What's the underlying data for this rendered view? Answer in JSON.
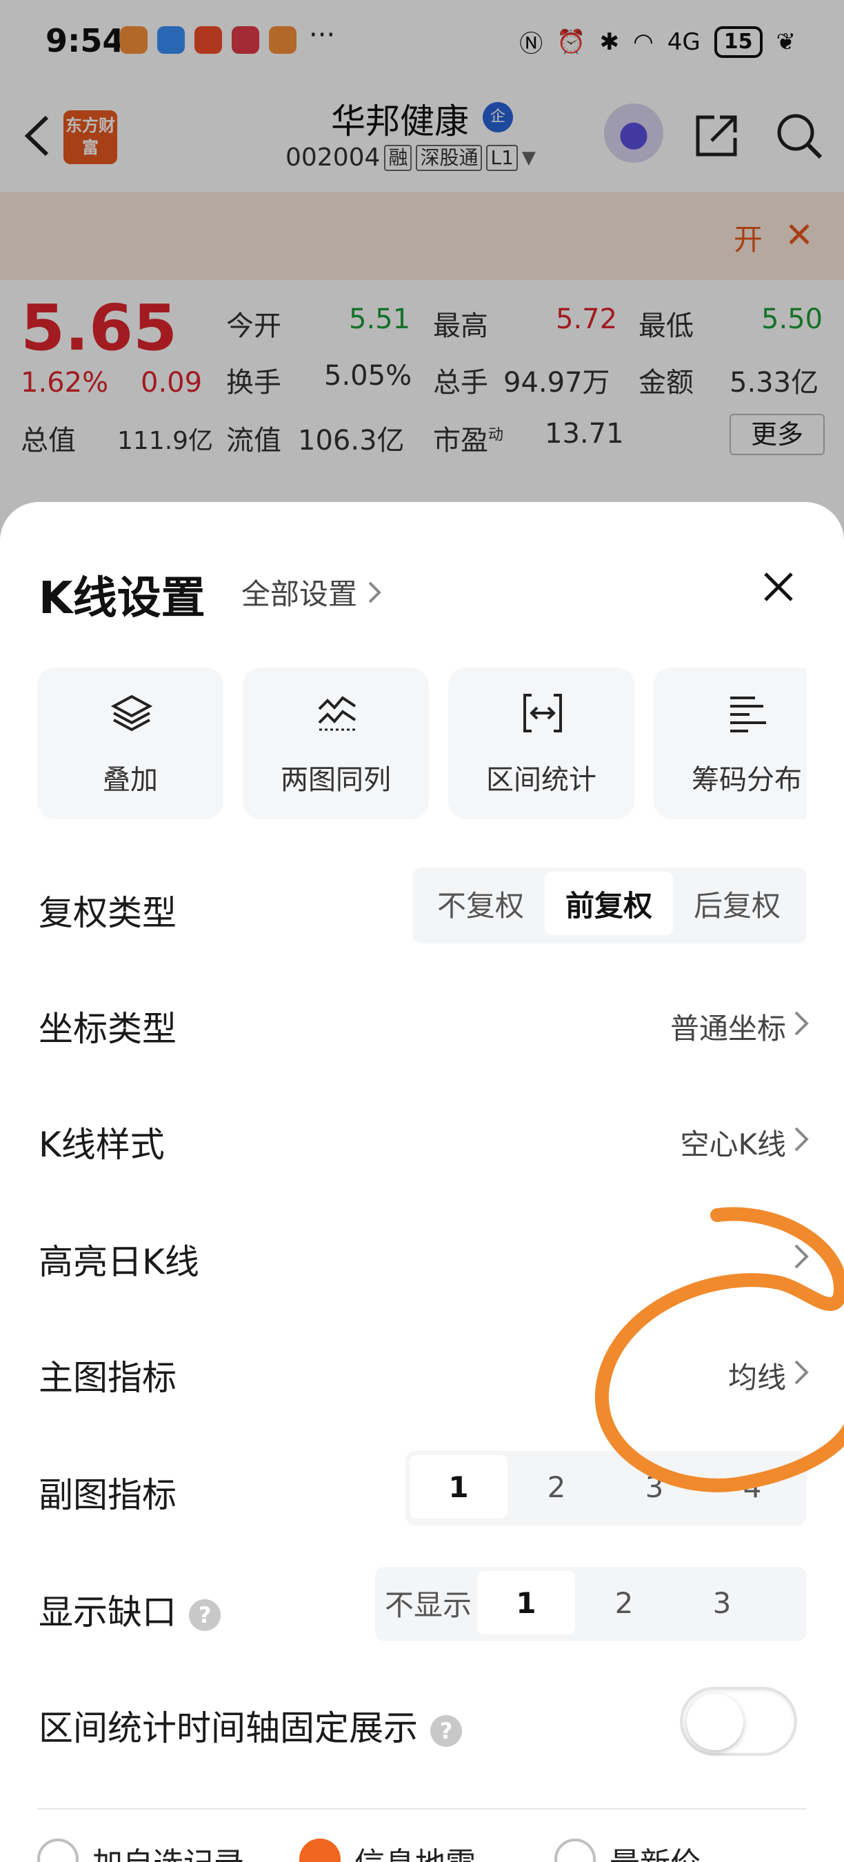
{
  "status_bar": {
    "time": "9:54",
    "more": "···",
    "battery": "15",
    "signal": "4G"
  },
  "header": {
    "back_icon": "chevron-left-icon",
    "logo_text": "东方财富",
    "stock_name": "华邦健康",
    "company_badge": "企",
    "stock_code": "002004",
    "tags": [
      "融",
      "深股通",
      "L1"
    ]
  },
  "banner": {
    "text": "开",
    "close": "✕"
  },
  "quote": {
    "price": "5.65",
    "change_pct": "1.62%",
    "change_amt": "0.09",
    "fields": [
      {
        "label": "今开",
        "value": "5.51",
        "color": "green"
      },
      {
        "label": "最高",
        "value": "5.72",
        "color": "red"
      },
      {
        "label": "最低",
        "value": "5.50",
        "color": "green"
      },
      {
        "label": "换手",
        "value": "5.05%",
        "color": "plain"
      },
      {
        "label": "总手",
        "value": "94.97万",
        "color": "plain"
      },
      {
        "label": "金额",
        "value": "5.33亿",
        "color": "plain"
      },
      {
        "label": "总值",
        "value": "111.9亿",
        "color": "plain"
      },
      {
        "label": "流值",
        "value": "106.3亿",
        "color": "plain"
      },
      {
        "label": "市盈",
        "sup": "动",
        "value": "13.71",
        "color": "plain"
      }
    ],
    "more_label": "更多"
  },
  "sheet": {
    "title": "K线设置",
    "all_settings": "全部设置",
    "tools": [
      {
        "label": "叠加",
        "icon": "layers-icon"
      },
      {
        "label": "两图同列",
        "icon": "dual-chart-icon"
      },
      {
        "label": "区间统计",
        "icon": "range-icon"
      },
      {
        "label": "筹码分布",
        "icon": "bars-icon"
      }
    ],
    "adjust": {
      "label": "复权类型",
      "options": [
        "不复权",
        "前复权",
        "后复权"
      ],
      "selected": "前复权"
    },
    "axis": {
      "label": "坐标类型",
      "value": "普通坐标"
    },
    "kline_style": {
      "label": "K线样式",
      "value": "空心K线"
    },
    "highlight": {
      "label": "高亮日K线",
      "value": ""
    },
    "main_indicator": {
      "label": "主图指标",
      "value": "均线"
    },
    "sub_indicator": {
      "label": "副图指标",
      "options": [
        "1",
        "2",
        "3",
        "4"
      ],
      "selected": "1"
    },
    "gap": {
      "label": "显示缺口",
      "help": "?",
      "options": [
        "不显示",
        "1",
        "2",
        "3"
      ],
      "selected": "1"
    },
    "axis_fixed": {
      "label": "区间统计时间轴固定展示",
      "help": "?",
      "enabled": false
    },
    "price_lines": [
      "加自选记录",
      "信息地雷",
      "最新价"
    ],
    "price_lines_selected": "信息地雷"
  },
  "colors": {
    "accent": "#f0661e",
    "up": "#e0262e",
    "down": "#1d9e3a",
    "annotation": "#f08a2c"
  }
}
